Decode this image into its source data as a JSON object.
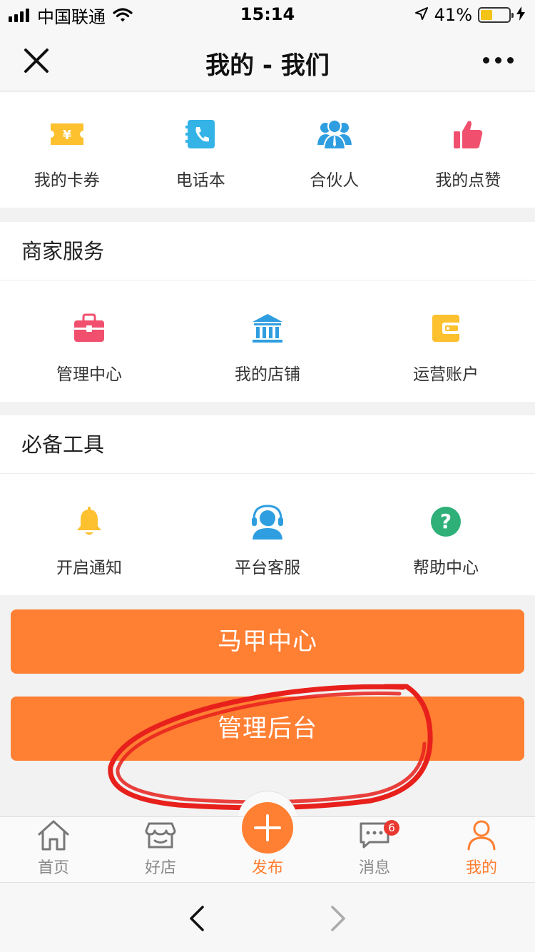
{
  "status_bar": {
    "carrier": "中国联通",
    "time": "15:14",
    "battery": "41%",
    "battery_level": 0.41
  },
  "nav": {
    "title": "我的 - 我们"
  },
  "top_grid": [
    {
      "label": "我的卡券",
      "icon": "ticket-icon"
    },
    {
      "label": "电话本",
      "icon": "phonebook-icon"
    },
    {
      "label": "合伙人",
      "icon": "partner-icon"
    },
    {
      "label": "我的点赞",
      "icon": "thumbs-up-icon"
    }
  ],
  "merchant": {
    "title": "商家服务",
    "items": [
      {
        "label": "管理中心",
        "icon": "briefcase-icon"
      },
      {
        "label": "我的店铺",
        "icon": "bank-icon"
      },
      {
        "label": "运营账户",
        "icon": "wallet-icon"
      }
    ]
  },
  "tools": {
    "title": "必备工具",
    "items": [
      {
        "label": "开启通知",
        "icon": "bell-icon"
      },
      {
        "label": "平台客服",
        "icon": "headset-icon"
      },
      {
        "label": "帮助中心",
        "icon": "question-icon"
      }
    ]
  },
  "buttons": {
    "vest_center": "马甲中心",
    "admin_backend": "管理后台"
  },
  "tab_bar": {
    "items": [
      {
        "label": "首页",
        "icon": "home-icon"
      },
      {
        "label": "好店",
        "icon": "store-icon"
      },
      {
        "label": "发布",
        "icon": "plus-icon"
      },
      {
        "label": "消息",
        "icon": "message-icon"
      },
      {
        "label": "我的",
        "icon": "person-icon"
      }
    ],
    "message_badge": "6",
    "active": "我的"
  },
  "colors": {
    "accent": "#ff7f33",
    "annotation": "#e8201c"
  }
}
